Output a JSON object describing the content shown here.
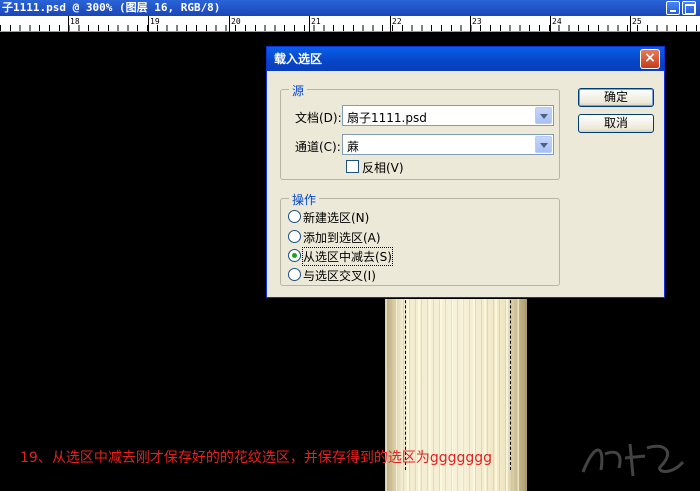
{
  "window": {
    "title": "子1111.psd @ 300% (图层 16, RGB/8)"
  },
  "ruler": {
    "labels": [
      "18",
      "19",
      "20",
      "21",
      "22",
      "23",
      "24",
      "25"
    ]
  },
  "dialog": {
    "title": "载入选区",
    "close_glyph": "×",
    "source": {
      "legend": "源",
      "document_label": "文档(D):",
      "document_value": "扇子1111.psd",
      "channel_label": "通道(C):",
      "channel_value": "蔴",
      "invert_label": "反相(V)",
      "invert_checked": false
    },
    "operation": {
      "legend": "操作",
      "options": [
        {
          "label": "新建选区(N)",
          "checked": false
        },
        {
          "label": "添加到选区(A)",
          "checked": false
        },
        {
          "label": "从选区中减去(S)",
          "checked": true
        },
        {
          "label": "与选区交叉(I)",
          "checked": false
        }
      ]
    },
    "ok_label": "确定",
    "cancel_label": "取消"
  },
  "caption": "19、从选区中减去刚才保存好的的花纹选区，并保存得到的选区为ggggggg",
  "colors": {
    "caption": "#e42020",
    "dialog_title": "#0a5fe8",
    "group_legend": "#0046d5"
  }
}
